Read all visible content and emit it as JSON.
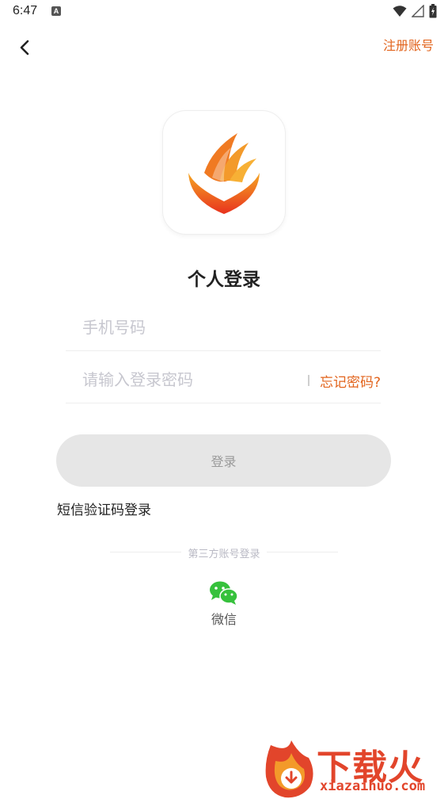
{
  "status_bar": {
    "time": "6:47",
    "icons": [
      "notification-a-icon",
      "wifi-icon",
      "signal-icon",
      "battery-icon"
    ]
  },
  "nav": {
    "back_icon": "chevron-left-icon",
    "register_label": "注册账号"
  },
  "page": {
    "title": "个人登录"
  },
  "form": {
    "phone_placeholder": "手机号码",
    "phone_value": "",
    "password_placeholder": "请输入登录密码",
    "password_value": "",
    "forgot_label": "忘记密码?",
    "login_label": "登录",
    "sms_login_label": "短信验证码登录"
  },
  "third_party": {
    "label": "第三方账号登录",
    "wechat_label": "微信"
  },
  "watermark": {
    "brand": "下载火",
    "url": "xiazaihuo.com"
  },
  "colors": {
    "accent": "#e2641d",
    "button_bg": "#e6e6e6",
    "wechat_green": "#36c13c",
    "watermark_red": "#e2452b"
  }
}
